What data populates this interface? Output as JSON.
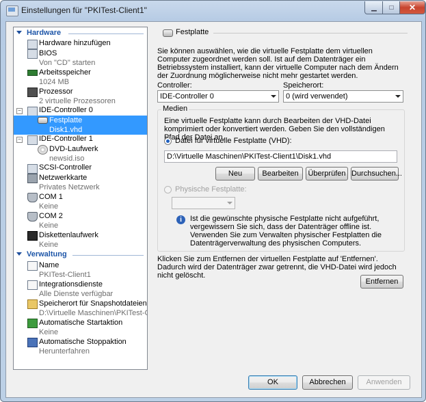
{
  "window": {
    "title": "Einstellungen für \"PKITest-Client1\"",
    "min": "▁",
    "max": "□",
    "close": "✕"
  },
  "tree": {
    "hardware_label": "Hardware",
    "verwaltung_label": "Verwaltung",
    "items": [
      {
        "title": "Hardware hinzufügen",
        "sub": "",
        "icon": "add-hardware-icon"
      },
      {
        "title": "BIOS",
        "sub": "Von \"CD\" starten",
        "icon": "bios-icon"
      },
      {
        "title": "Arbeitsspeicher",
        "sub": "1024 MB",
        "icon": "memory-icon"
      },
      {
        "title": "Prozessor",
        "sub": "2 virtuelle Prozessoren",
        "icon": "processor-icon"
      },
      {
        "title": "IDE-Controller 0",
        "sub": "",
        "icon": "ide-controller-icon"
      },
      {
        "title": "Festplatte",
        "sub": "Disk1.vhd",
        "icon": "hard-disk-icon"
      },
      {
        "title": "IDE-Controller 1",
        "sub": "",
        "icon": "ide-controller-icon"
      },
      {
        "title": "DVD-Laufwerk",
        "sub": "newsid.iso",
        "icon": "dvd-drive-icon"
      },
      {
        "title": "SCSI-Controller",
        "sub": "",
        "icon": "scsi-controller-icon"
      },
      {
        "title": "Netzwerkkarte",
        "sub": "Privates Netzwerk",
        "icon": "network-adapter-icon"
      },
      {
        "title": "COM 1",
        "sub": "Keine",
        "icon": "com-port-icon"
      },
      {
        "title": "COM 2",
        "sub": "Keine",
        "icon": "com-port-icon"
      },
      {
        "title": "Diskettenlaufwerk",
        "sub": "Keine",
        "icon": "floppy-icon"
      },
      {
        "title": "Name",
        "sub": "PKITest-Client1",
        "icon": "name-icon"
      },
      {
        "title": "Integrationsdienste",
        "sub": "Alle Dienste verfügbar",
        "icon": "integration-services-icon"
      },
      {
        "title": "Speicherort für Snapshotdateien",
        "sub": "D:\\Virtuelle Maschinen\\PKITest-Cli...",
        "icon": "snapshot-folder-icon"
      },
      {
        "title": "Automatische Startaktion",
        "sub": "Keine",
        "icon": "auto-start-icon"
      },
      {
        "title": "Automatische Stoppaktion",
        "sub": "Herunterfahren",
        "icon": "auto-stop-icon"
      }
    ]
  },
  "panel": {
    "title": "Festplatte",
    "intro": "Sie können auswählen, wie die virtuelle Festplatte dem virtuellen Computer zugeordnet werden soll. Ist auf dem Datenträger ein Betriebssystem installiert, kann der virtuelle Computer nach dem Ändern der Zuordnung möglicherweise nicht mehr gestartet werden.",
    "controller_label": "Controller:",
    "controller_value": "IDE-Controller 0",
    "location_label": "Speicherort:",
    "location_value": "0 (wird verwendet)",
    "media_label": "Medien",
    "media_text": "Eine virtuelle Festplatte kann durch Bearbeiten der VHD-Datei komprimiert oder konvertiert werden. Geben Sie den vollständigen Pfad der Datei an.",
    "vhd_radio_label": "Datei für virtuelle Festplatte (VHD):",
    "vhd_path": "D:\\Virtuelle Maschinen\\PKITest-Client1\\Disk1.vhd",
    "btn_new": "Neu",
    "btn_edit": "Bearbeiten",
    "btn_inspect": "Überprüfen",
    "btn_browse": "Durchsuchen...",
    "physical_radio_label": "Physische Festplatte:",
    "physical_value": "",
    "info_text": "Ist die gewünschte physische Festplatte nicht aufgeführt, vergewissern Sie sich, dass der Datenträger offline ist. Verwenden Sie zum Verwalten physischer Festplatten die Datenträgerverwaltung des physischen Computers.",
    "remove_text": "Klicken Sie zum Entfernen der virtuellen Festplatte auf 'Entfernen'. Dadurch wird der Datenträger zwar getrennt, die VHD-Datei wird jedoch nicht gelöscht.",
    "btn_remove": "Entfernen"
  },
  "footer": {
    "ok": "OK",
    "cancel": "Abbrechen",
    "apply": "Anwenden"
  },
  "colors": {
    "selection": "#3399ff",
    "section_header": "#1e56a8"
  }
}
